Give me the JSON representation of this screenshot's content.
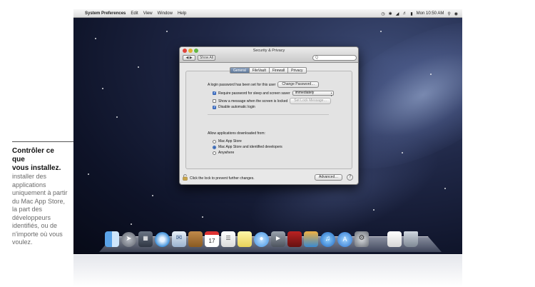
{
  "caption": {
    "title_line1": "Contrôler ce",
    "title_line2": "que",
    "title_line3": "vous installez.",
    "body": "installer des applications uniquement à partir du Mac App Store, la part des développeurs identifiés, ou de n'importe où vous voulez."
  },
  "menubar": {
    "apple": "",
    "app_name": "System Preferences",
    "items": [
      "Edit",
      "View",
      "Window",
      "Help"
    ],
    "clock": "Mon 10:50 AM"
  },
  "window": {
    "title": "Security & Privacy",
    "show_all": "Show All",
    "search_placeholder": "Q",
    "tabs": [
      "General",
      "FileVault",
      "Firewall",
      "Privacy"
    ],
    "password_set_label": "A login password has been set for this user",
    "change_password": "Change Password…",
    "require_password_label": "Require password for sleep and screen saver",
    "require_password_value": "immediately",
    "show_message_label": "Show a message when the screen is locked",
    "set_lock_message": "Set Lock Message…",
    "disable_auto_login": "Disable automatic login",
    "allow_apps_label": "Allow applications downloaded from:",
    "options": [
      "Mac App Store",
      "Mac App Store and identified developers",
      "Anywhere"
    ],
    "lock_text": "Click the lock to prevent further changes.",
    "advanced": "Advanced…",
    "help": "?"
  },
  "dock": {
    "icons": [
      "finder-icon",
      "launchpad-icon",
      "mission-control-icon",
      "safari-icon",
      "mail-icon",
      "contacts-icon",
      "calendar-icon",
      "reminders-icon",
      "notes-icon",
      "messages-icon",
      "facetime-icon",
      "photo-booth-icon",
      "iphoto-icon",
      "itunes-icon",
      "app-store-icon",
      "system-preferences-icon",
      "preview-icon",
      "trash-icon"
    ],
    "calendar_day": "17"
  },
  "colors": {
    "accent": "#4a7bd0",
    "desktop": "#1f2746"
  }
}
